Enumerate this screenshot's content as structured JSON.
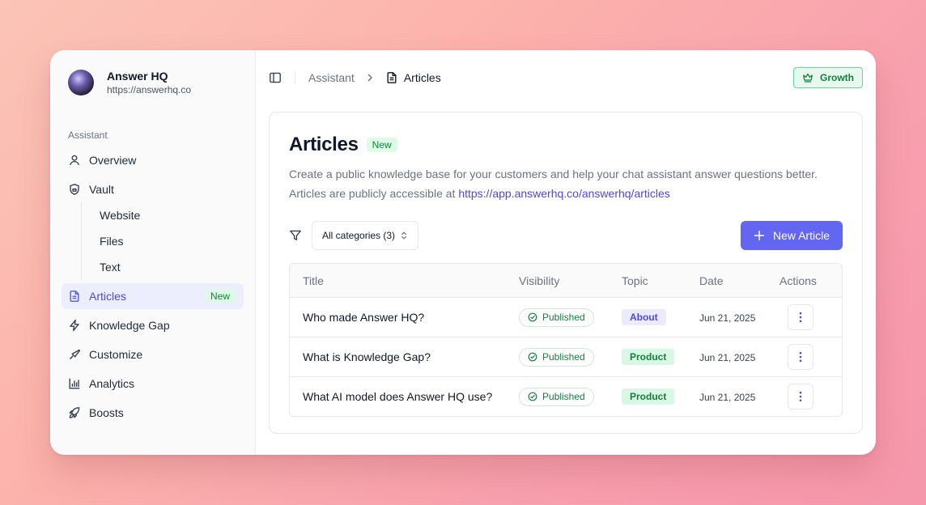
{
  "org": {
    "name": "Answer HQ",
    "url": "https://answerhq.co"
  },
  "sidebar": {
    "section_label": "Assistant",
    "items": {
      "overview": "Overview",
      "vault": "Vault",
      "website": "Website",
      "files": "Files",
      "text": "Text",
      "articles": "Articles",
      "articles_badge": "New",
      "knowledge_gap": "Knowledge Gap",
      "customize": "Customize",
      "analytics": "Analytics",
      "boosts": "Boosts"
    }
  },
  "breadcrumb": {
    "parent": "Assistant",
    "current": "Articles"
  },
  "plan": {
    "label": "Growth"
  },
  "page": {
    "title": "Articles",
    "title_badge": "New",
    "desc_line1": "Create a public knowledge base for your customers and help your chat assistant answer questions better.",
    "desc_line2_prefix": "Articles are publicly accessible at ",
    "desc_link": "https://app.answerhq.co/answerhq/articles"
  },
  "toolbar": {
    "category_select": "All categories (3)",
    "new_article": "New Article"
  },
  "table": {
    "headers": {
      "title": "Title",
      "visibility": "Visibility",
      "topic": "Topic",
      "date": "Date",
      "actions": "Actions"
    },
    "rows": [
      {
        "title": "Who made Answer HQ?",
        "visibility": "Published",
        "topic": "About",
        "date": "Jun 21, 2025"
      },
      {
        "title": "What is Knowledge Gap?",
        "visibility": "Published",
        "topic": "Product",
        "date": "Jun 21, 2025"
      },
      {
        "title": "What AI model does Answer HQ use?",
        "visibility": "Published",
        "topic": "Product",
        "date": "Jun 21, 2025"
      }
    ]
  },
  "colors": {
    "accent": "#6366f1",
    "success": "#15803d",
    "active_bg": "#eceefe"
  }
}
